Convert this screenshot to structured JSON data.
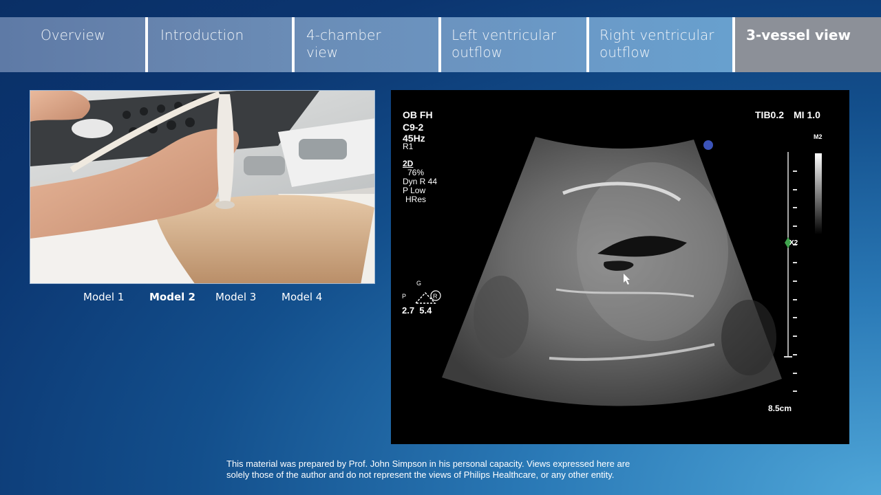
{
  "nav": {
    "tabs": [
      {
        "label": "Overview",
        "active": false
      },
      {
        "label": "Introduction",
        "active": false
      },
      {
        "label": "4-chamber view",
        "active": false
      },
      {
        "label": "Left ventricular outflow",
        "active": false
      },
      {
        "label": "Right ventricular outflow",
        "active": false
      },
      {
        "label": "3-vessel view",
        "active": true
      }
    ]
  },
  "models": {
    "items": [
      "Model 1",
      "Model 2",
      "Model 3",
      "Model 4"
    ],
    "selected": "Model 2"
  },
  "ultrasound": {
    "preset": "OB FH",
    "transducer": "C9-2",
    "frame_rate": "45Hz",
    "resolution": "R1",
    "mode": "2D",
    "gain": "76%",
    "dyn_range": "Dyn R 44",
    "power": "P Low",
    "res_mode": "HRes",
    "tib": "TIB0.2",
    "mi": "MI 1.0",
    "map": "M2",
    "focus_marker": "X2",
    "depth": "8.5cm",
    "orientation_g": "G",
    "orientation_p": "P",
    "orientation_r": "R",
    "orientation_values": "2.7  5.4",
    "probe_marker": "P"
  },
  "footer": {
    "disclaimer_line1": "This material was prepared by Prof. John Simpson in his personal capacity. Views expressed here are",
    "disclaimer_line2": "solely those of the author and do not represent the views of Philips Healthcare, or any other entity."
  }
}
